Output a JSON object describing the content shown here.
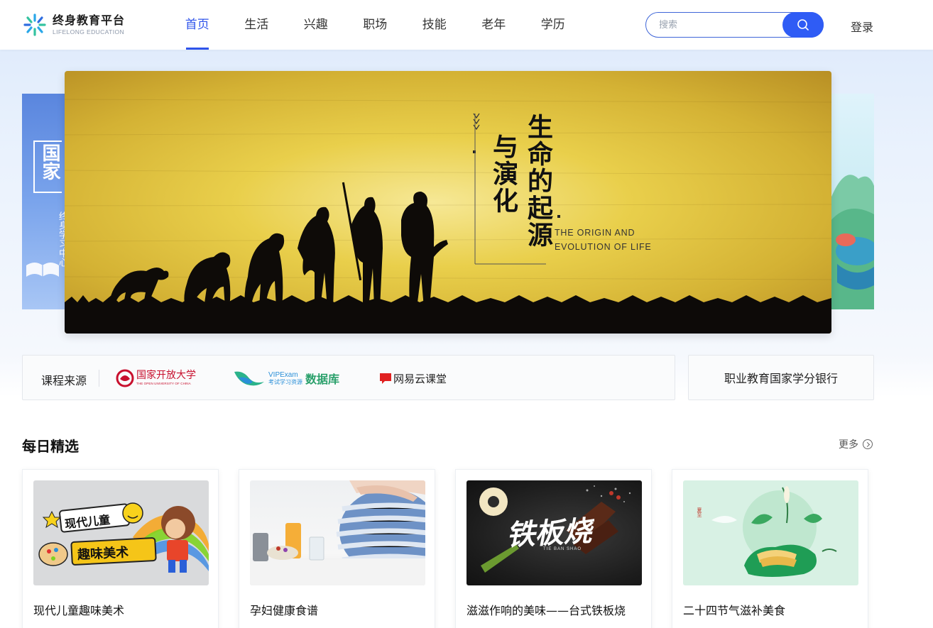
{
  "header": {
    "logo_title": "终身教育平台",
    "logo_subtitle": "LIFELONG EDUCATION",
    "nav": [
      {
        "label": "首页",
        "active": true
      },
      {
        "label": "生活",
        "active": false
      },
      {
        "label": "兴趣",
        "active": false
      },
      {
        "label": "职场",
        "active": false
      },
      {
        "label": "技能",
        "active": false
      },
      {
        "label": "老年",
        "active": false
      },
      {
        "label": "学历",
        "active": false
      }
    ],
    "search_placeholder": "搜索",
    "search_value": "",
    "login_label": "登录",
    "accent_color": "#2f54eb"
  },
  "banner": {
    "title_main": "生命的起源",
    "title_sub": "与演化",
    "subtitle_en_line1": "THE ORIGIN AND",
    "subtitle_en_line2": "EVOLUTION OF LIFE",
    "left_slide_text": "国家",
    "left_slide_subtext": "终身学习中心"
  },
  "sources": {
    "label": "课程来源",
    "items": [
      {
        "name": "国家开放大学",
        "sub": "THE OPEN UNIVERSITY OF CHINA",
        "color": "#c8102e"
      },
      {
        "name": "数据库",
        "prefix": "VIPExam",
        "prefix_sub": "考试学习资源",
        "color": "#2aa06b"
      },
      {
        "name": "网易云课堂",
        "color": "#e02020"
      }
    ]
  },
  "credit_bank": {
    "label": "职业教育国家学分银行"
  },
  "daily": {
    "title": "每日精选",
    "more_label": "更多",
    "cards": [
      {
        "title": "现代儿童趣味美术",
        "img_text_1": "现代儿童",
        "img_text_2": "趣味美术"
      },
      {
        "title": "孕妇健康食谱"
      },
      {
        "title": "滋滋作响的美味——台式铁板烧",
        "img_text_1": "铁板烧",
        "img_text_2": "TIE BAN SHAO"
      },
      {
        "title": "二十四节气滋补美食",
        "img_text_1": "夏至"
      }
    ]
  }
}
